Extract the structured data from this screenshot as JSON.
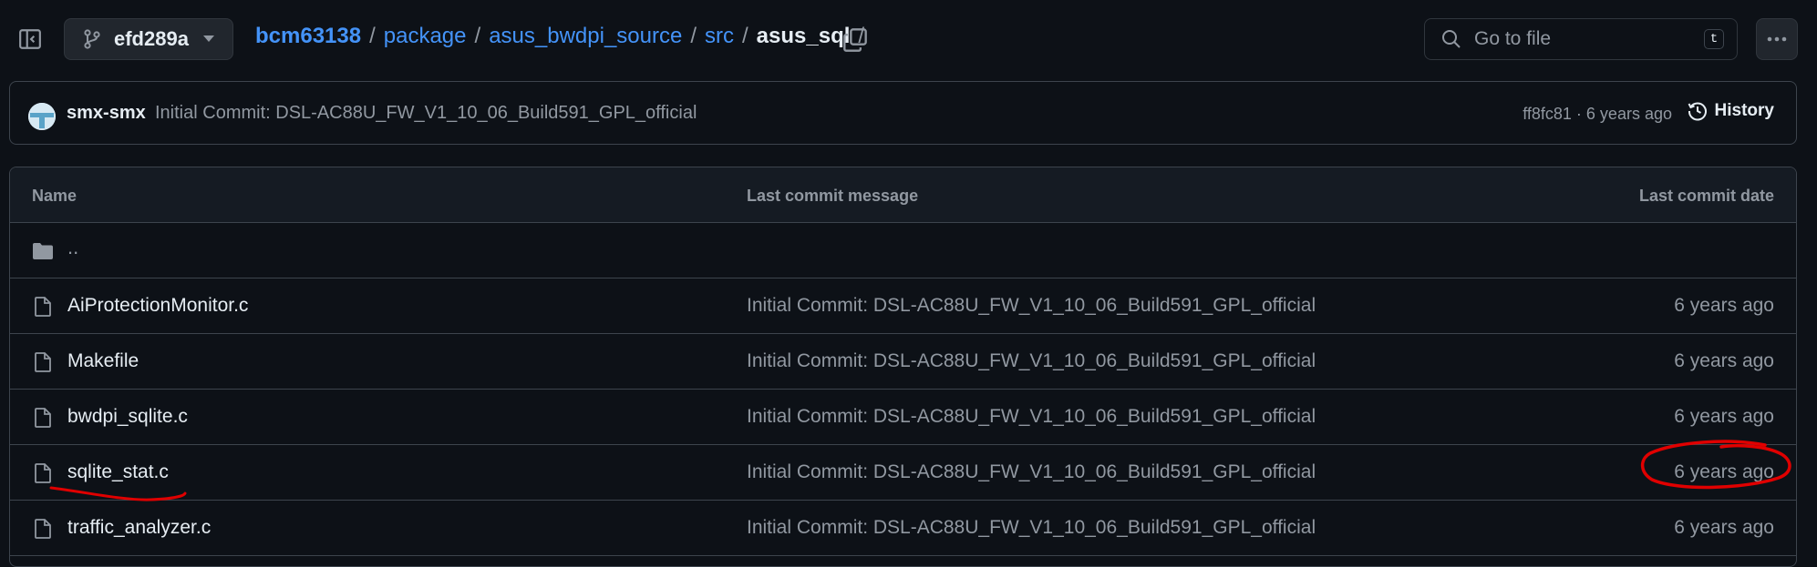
{
  "branch": {
    "name": "efd289a"
  },
  "breadcrumb": {
    "items": [
      "bcm63138",
      "package",
      "asus_bwdpi_source",
      "src"
    ],
    "current": "asus_sql",
    "separator": "/"
  },
  "search": {
    "placeholder": "Go to file",
    "shortcut": "t"
  },
  "commit": {
    "author": "smx-smx",
    "message": "Initial Commit: DSL-AC88U_FW_V1_10_06_Build591_GPL_official",
    "meta": "ff8fc81 · 6 years ago",
    "history_label": "History"
  },
  "table": {
    "headers": {
      "name": "Name",
      "message": "Last commit message",
      "date": "Last commit date"
    },
    "parent": "..",
    "rows": [
      {
        "name": "AiProtectionMonitor.c",
        "message": "Initial Commit: DSL-AC88U_FW_V1_10_06_Build591_GPL_official",
        "date": "6 years ago"
      },
      {
        "name": "Makefile",
        "message": "Initial Commit: DSL-AC88U_FW_V1_10_06_Build591_GPL_official",
        "date": "6 years ago"
      },
      {
        "name": "bwdpi_sqlite.c",
        "message": "Initial Commit: DSL-AC88U_FW_V1_10_06_Build591_GPL_official",
        "date": "6 years ago"
      },
      {
        "name": "sqlite_stat.c",
        "message": "Initial Commit: DSL-AC88U_FW_V1_10_06_Build591_GPL_official",
        "date": "6 years ago"
      },
      {
        "name": "traffic_analyzer.c",
        "message": "Initial Commit: DSL-AC88U_FW_V1_10_06_Build591_GPL_official",
        "date": "6 years ago"
      }
    ]
  },
  "colors": {
    "background": "#0d1117",
    "link": "#4493f8",
    "muted": "#9198a1",
    "annotation": "#e00000"
  }
}
